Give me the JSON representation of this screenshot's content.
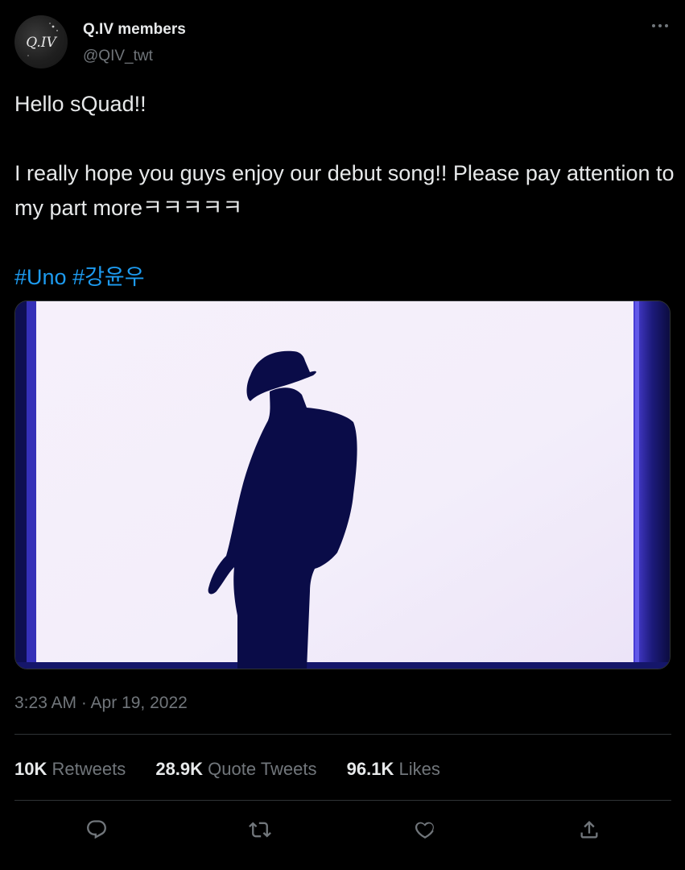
{
  "author": {
    "display_name": "Q.IV members",
    "handle": "@QIV_twt",
    "avatar_text": "Q.IV"
  },
  "tweet": {
    "line1": "Hello sQuad!!",
    "line2": "I really hope you guys enjoy our debut song!! Please pay attention to my part moreㅋㅋㅋㅋㅋ",
    "hashtags": [
      "#Uno",
      "#강윤우"
    ]
  },
  "timestamp": "3:23 AM · Apr 19, 2022",
  "stats": [
    {
      "value": "10K",
      "label": "Retweets"
    },
    {
      "value": "28.9K",
      "label": "Quote Tweets"
    },
    {
      "value": "96.1K",
      "label": "Likes"
    }
  ],
  "actions": [
    "reply-icon",
    "retweet-icon",
    "like-icon",
    "share-icon"
  ],
  "colors": {
    "background": "#000000",
    "text": "#e7e9ea",
    "secondary": "#71767b",
    "accent": "#1d9bf0",
    "divider": "#2f3336"
  }
}
